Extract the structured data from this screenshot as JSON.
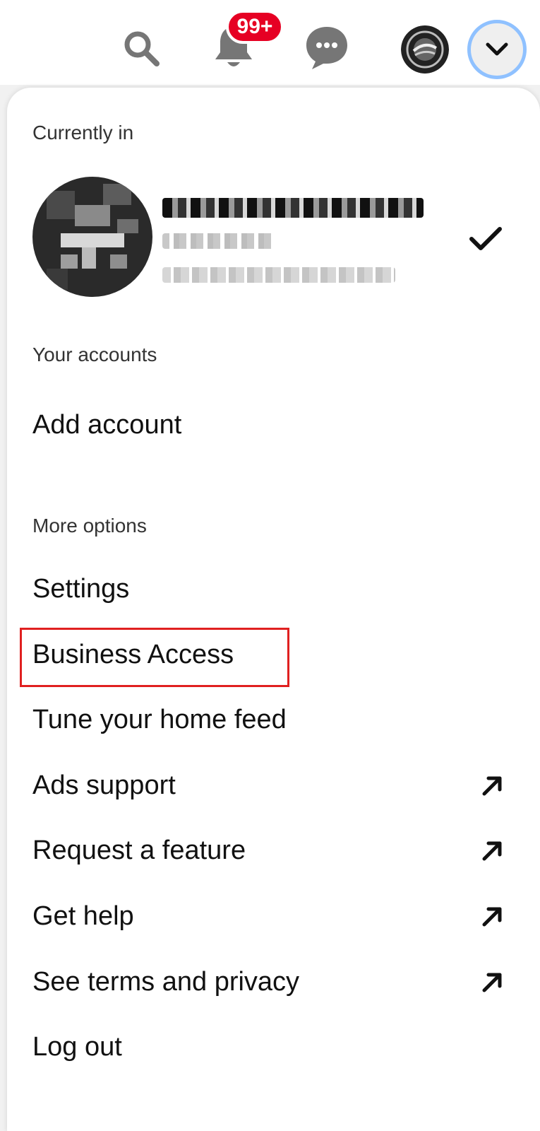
{
  "header": {
    "notification_count": "99+",
    "icons": [
      "search-icon",
      "bell-icon",
      "chat-icon",
      "profile-avatar",
      "chevron-down-icon"
    ]
  },
  "menu": {
    "currently_in_label": "Currently in",
    "your_accounts_label": "Your accounts",
    "add_account": "Add account",
    "more_options_label": "More options",
    "items": [
      {
        "label": "Settings",
        "external": false
      },
      {
        "label": "Business Access",
        "external": false,
        "highlighted": true
      },
      {
        "label": "Tune your home feed",
        "external": false
      },
      {
        "label": "Ads support",
        "external": true
      },
      {
        "label": "Request a feature",
        "external": true
      },
      {
        "label": "Get help",
        "external": true
      },
      {
        "label": "See terms and privacy",
        "external": true
      },
      {
        "label": "Log out",
        "external": false
      }
    ]
  },
  "colors": {
    "badge": "#e60023",
    "focus_ring": "#8fc1ff",
    "highlight_box": "#e02020"
  }
}
